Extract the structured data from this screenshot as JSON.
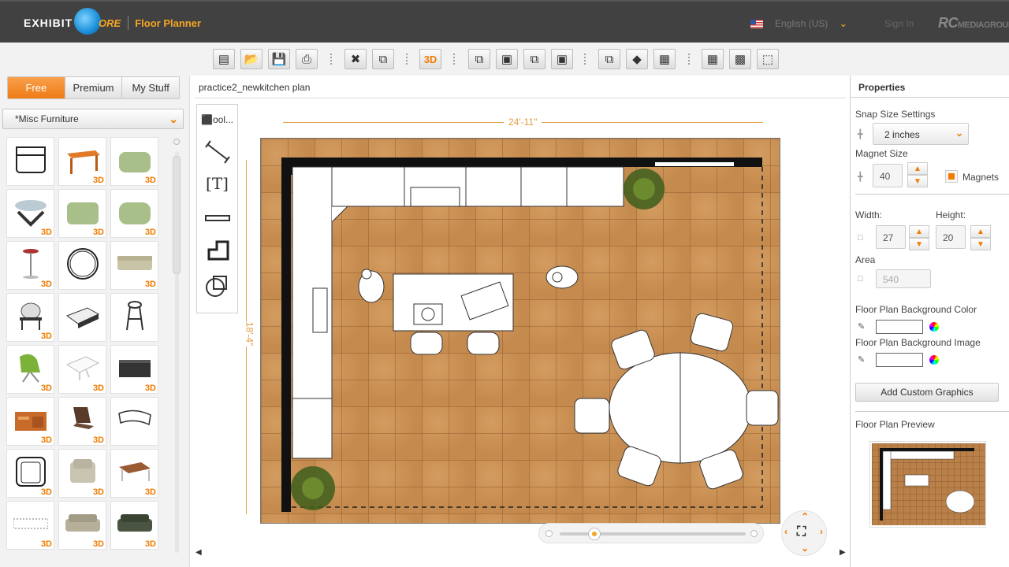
{
  "header": {
    "brand_left": "EXHIBIT",
    "brand_right": "ORE",
    "app_name": "Floor Planner",
    "language": "English (US)",
    "signin": "Sign In",
    "partner": "MEDIAGROUP"
  },
  "toolbar": {
    "btn_3d": "3D"
  },
  "library": {
    "tabs": [
      "Free",
      "Premium",
      "My Stuff"
    ],
    "active_tab": "Free",
    "category": "*Misc Furniture",
    "badge_3d": "3D"
  },
  "canvas": {
    "plan_title": "practice2_newkitchen plan",
    "width_label": "24'-11\"",
    "height_label": "18'-4\"",
    "tool_label": "ool..."
  },
  "properties": {
    "title": "Properties",
    "snap_label": "Snap Size Settings",
    "snap_value": "2 inches",
    "magnet_label": "Magnet Size",
    "magnet_value": "40",
    "magnets_label": "Magnets",
    "width_label": "Width:",
    "width_value": "27",
    "height_label": "Height:",
    "height_value": "20",
    "area_label": "Area",
    "area_value": "540",
    "bg_color_label": "Floor Plan Background Color",
    "bg_image_label": "Floor Plan Background Image",
    "add_custom_label": "Add Custom Graphics",
    "preview_label": "Floor Plan Preview"
  },
  "colors": {
    "accent": "#f07c00",
    "header_bg": "#414141",
    "floor": "#c58a4e"
  }
}
